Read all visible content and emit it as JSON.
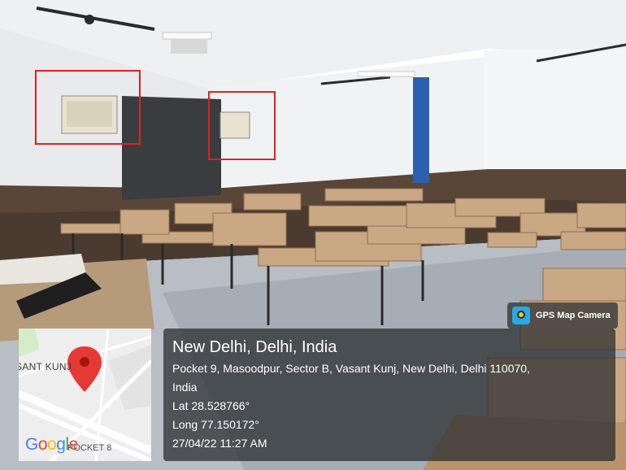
{
  "camera_badge": {
    "label": "GPS Map Camera",
    "icon": "gps-map-camera-icon"
  },
  "map": {
    "area_label": "SANT KUNJ",
    "area_label_2": "POCKET 8",
    "logo_text": "Google",
    "logo_colors": [
      "#4285F4",
      "#EA4335",
      "#FBBC05",
      "#4285F4",
      "#34A853",
      "#EA4335"
    ],
    "pin_color": "#E53935"
  },
  "location": {
    "title": "New Delhi, Delhi, India",
    "address_line_1": "Pocket 9, Masoodpur, Sector B, Vasant Kunj, New Delhi, Delhi 110070,",
    "address_line_2": "India",
    "latitude": "Lat 28.528766°",
    "longitude": "Long 77.150172°",
    "timestamp": "27/04/22 11:27 AM"
  },
  "annotations": {
    "box_color": "#E32020"
  }
}
